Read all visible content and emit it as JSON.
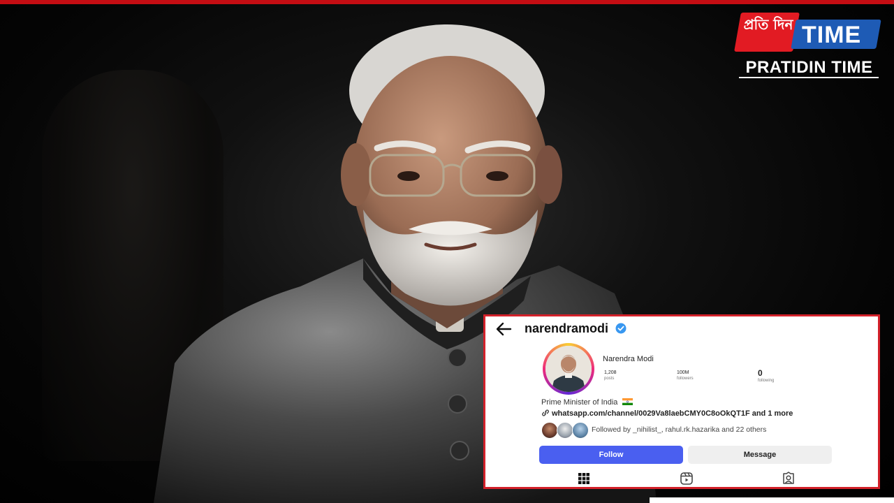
{
  "brand": {
    "logo_native_text": "প্ৰতি দিন",
    "logo_word": "TIME",
    "logo_caption": "PRATIDIN TIME",
    "colors": {
      "red": "#e21b23",
      "blue": "#1e5bb5",
      "frame_red": "#d3212a"
    }
  },
  "profile": {
    "username": "narendramodi",
    "verified_icon": "verified-badge-icon",
    "display_name": "Narendra Modi",
    "stats": [
      {
        "value": "1,208",
        "label": "posts"
      },
      {
        "value": "100M",
        "label": "followers"
      },
      {
        "value": "0",
        "label": "following"
      }
    ],
    "bio": "Prime Minister of India",
    "link": "whatsapp.com/channel/0029Va8laebCMY0C8oOkQT1F and 1 more",
    "followed_by": "Followed by _nihilist_, rahul.rk.hazarika and 22 others",
    "follow_label": "Follow",
    "message_label": "Message",
    "follow_color": "#4a5ff0"
  },
  "tabs": [
    {
      "icon": "grid-icon"
    },
    {
      "icon": "reels-icon"
    },
    {
      "icon": "tagged-icon"
    }
  ]
}
